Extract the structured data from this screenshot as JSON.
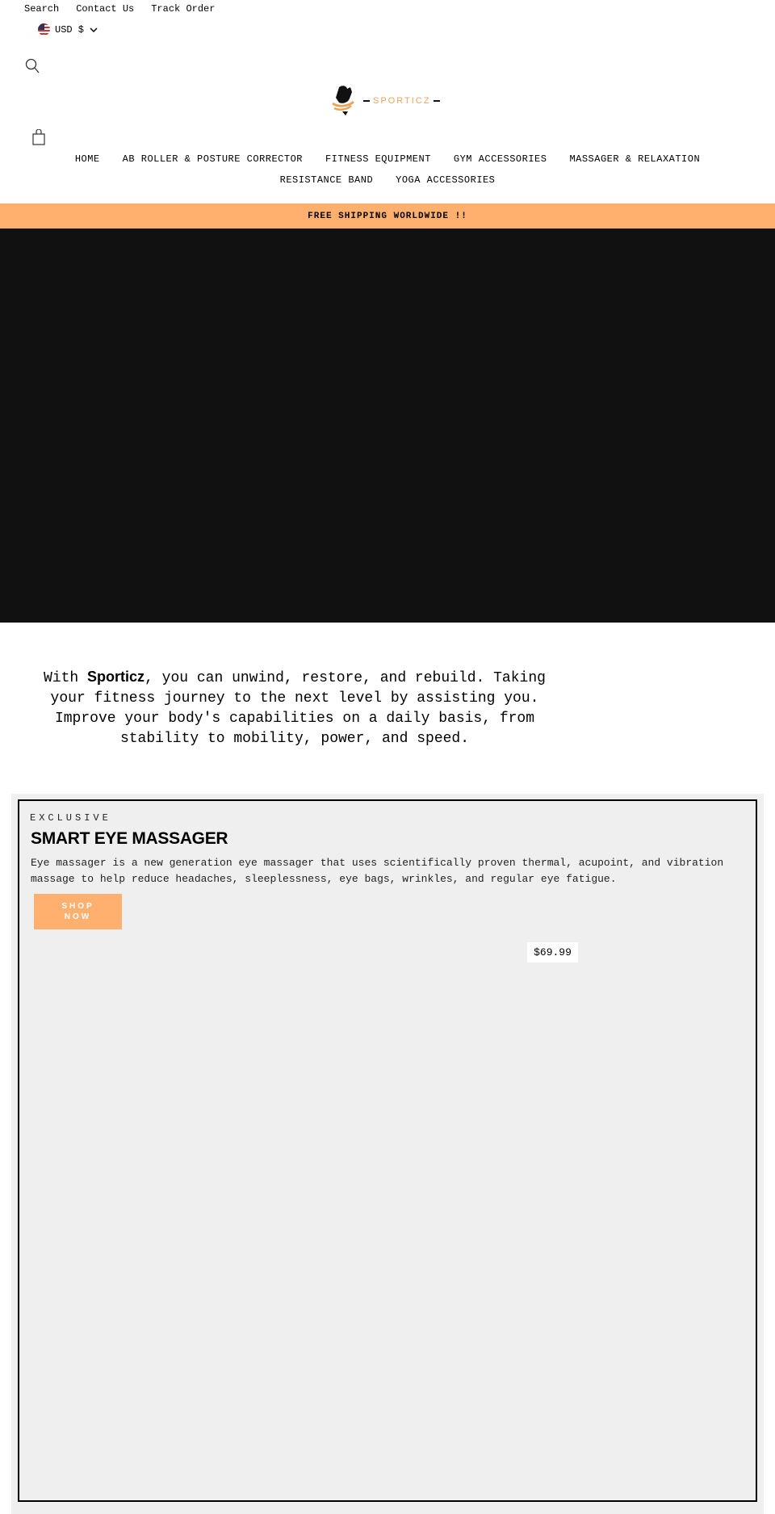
{
  "top_links": [
    "Search",
    "Contact Us",
    "Track Order"
  ],
  "currency": {
    "label": "USD $",
    "icon": "us-flag-icon"
  },
  "logo": {
    "text": "SPORTICZ",
    "accent": "#e9a55e"
  },
  "nav": {
    "row1": [
      "HOME",
      "AB ROLLER & POSTURE CORRECTOR",
      "FITNESS EQUIPMENT",
      "GYM ACCESSORIES",
      "MASSAGER & RELAXATION"
    ],
    "row2": [
      "RESISTANCE BAND",
      "YOGA ACCESSORIES"
    ]
  },
  "banner": {
    "text": "FREE SHIPPING WORLDWIDE !!",
    "color": "#ffaf6e"
  },
  "intro": {
    "pre": "With ",
    "brand": "Sporticz",
    "post": ", you can unwind, restore, and rebuild. Taking your fitness journey to the next level by assisting you. Improve your body's capabilities on a daily basis, from stability to mobility, power, and speed."
  },
  "feature": {
    "eyebrow": "EXCLUSIVE",
    "title": "SMART EYE MASSAGER",
    "description": "Eye massager is a new generation eye massager that uses scientifically proven thermal, acupoint, and vibration massage to help reduce headaches, sleeplessness, eye bags, wrinkles, and regular eye fatigue.",
    "button": "SHOP NOW",
    "price": "$69.99"
  }
}
